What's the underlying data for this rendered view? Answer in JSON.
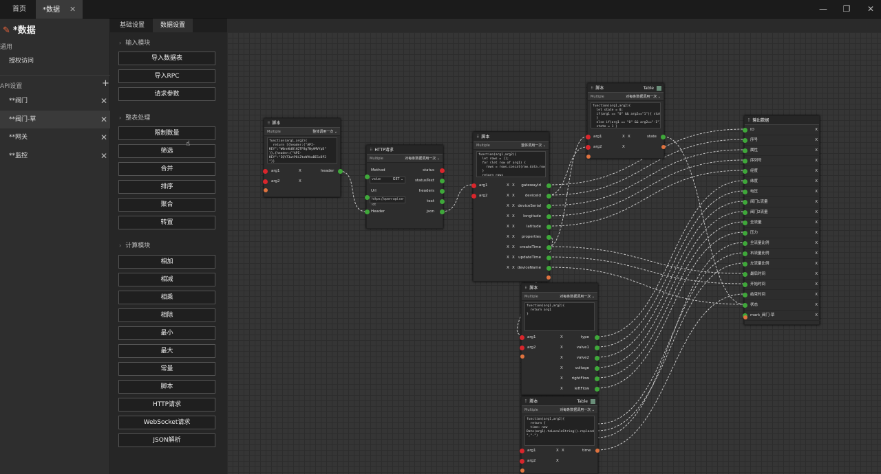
{
  "topbar": {
    "tab_home": "首页",
    "tab_data": "*数据"
  },
  "left": {
    "title": "*数据",
    "sec_general": "通用",
    "auth": "授权访问",
    "sec_api": "API设置",
    "items": [
      "**阀门",
      "**阀门-草",
      "**网关",
      "**监控"
    ]
  },
  "tools": {
    "tab_basic": "基础设置",
    "tab_data": "数据设置",
    "sec_input": "输入模块",
    "input_btns": [
      "导入数据表",
      "导入RPC",
      "请求参数"
    ],
    "sec_process": "整表处理",
    "process_btns": [
      "限制数量",
      "筛选",
      "合并",
      "排序",
      "聚合",
      "转置"
    ],
    "sec_calc": "计算模块",
    "calc_btns": [
      "相加",
      "相减",
      "相乘",
      "相除",
      "最小",
      "最大",
      "常量",
      "脚本",
      "HTTP请求",
      "WebSocket请求",
      "JSON解析"
    ]
  },
  "nodes": {
    "script_title": "脚本",
    "multiple": "Multiple",
    "opt_all": "整体调用一次",
    "opt_each": "对每条数据调用一次",
    "table_tag": "Table",
    "arg1": "arg1",
    "arg2": "arg2",
    "x": "X",
    "n1_code": "function(arg1,arg2){\n  return [{header:{\"API-\nKEY\":\"W0nnKdBlH2TF8g7NyAMVYpD\"\n}},{header:{\"API-\nKEY\":\"EQY73wtP8iZtoWVkaBESxDP2\n\"}}",
    "n1_out": "header",
    "http_title": "HTTP请求",
    "http_method": "Method",
    "http_value": "value",
    "http_get": "GET",
    "http_url": "Url",
    "http_url_val": "https://open-api.ce-iot",
    "http_header": "Header",
    "http_outs": [
      "status",
      "statusText",
      "headers",
      "text",
      "json"
    ],
    "n3_code": "function(arg1,arg2){\n  let rows = [];\n  for (let row of arg1) {\n    rows = rows.concat(row.data.rows)\n  }\n  return rows",
    "n3_outs": [
      "gatewayId",
      "deviceId",
      "deviceSerial",
      "longitude",
      "latitude",
      "properties",
      "createTime",
      "updateTime",
      "deviceName"
    ],
    "n4_code": "function(arg1,arg2){\n  let state = 0;\n  if(arg1 == \"0\" && arg2==\"1\"){ state = 1\n  }\n  else if(arg1 == \"0\" && arg2==\"-1\"){\n  state = 1 }",
    "n4_out": "state",
    "n5_code": "function(arg1,arg2){\n  return arg1\n}",
    "n5_outs": [
      "type",
      "valve1",
      "valve2",
      "voltage",
      "rightFlow",
      "leftFlow"
    ],
    "n6_code": "function(arg1,arg2){\n  return {\n  time: new\nDate(arg1).toLocaleString().replaceAll(\"\n\",\"-\")",
    "n6_out": "time",
    "out_title": "输出数据",
    "out_fields": [
      "ID",
      "序号",
      "属性",
      "序列号",
      "经度",
      "纬度",
      "电压",
      "阀门1流量",
      "阀门2流量",
      "全流量",
      "压力",
      "全流量比例",
      "右流量比例",
      "左流量比例",
      "最后时间",
      "开始时间",
      "结束时间",
      "状态",
      "mark_阀门-草"
    ]
  }
}
